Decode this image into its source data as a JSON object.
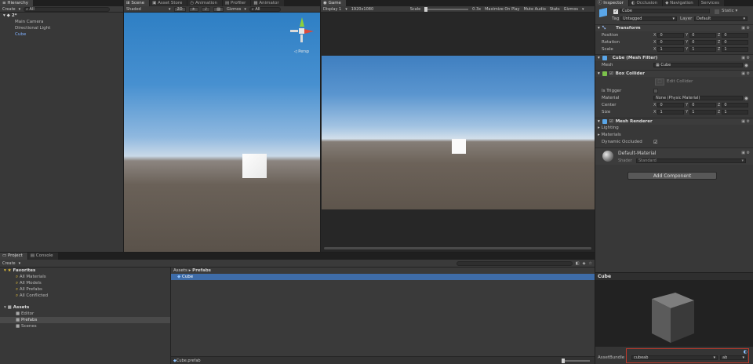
{
  "hierarchy": {
    "tab": "Hierarchy",
    "create": "Create",
    "search": "All",
    "scene": "2*",
    "items": [
      "Main Camera",
      "Directional Light",
      "Cube"
    ]
  },
  "scene_tabs": [
    "Scene",
    "Asset Store",
    "Animation",
    "Profiler",
    "Animator"
  ],
  "scene_toolbar": {
    "shading": "Shaded",
    "mode2d": "2D",
    "gizmos": "Gizmos",
    "search": "All",
    "persp": "Persp"
  },
  "game": {
    "tab": "Game",
    "display": "Display 1",
    "resolution": "1920x1080",
    "scale_label": "Scale",
    "scale_value": "0.3x",
    "maximize": "Maximize On Play",
    "mute": "Mute Audio",
    "stats": "Stats",
    "gizmos": "Gizmos"
  },
  "inspector": {
    "tabs": [
      "Inspector",
      "Occlusion",
      "Navigation",
      "Services"
    ],
    "object_name": "Cube",
    "static_label": "Static",
    "tag_label": "Tag",
    "tag_value": "Untagged",
    "layer_label": "Layer",
    "layer_value": "Default",
    "transform": {
      "title": "Transform",
      "position_label": "Position",
      "rotation_label": "Rotation",
      "scale_label": "Scale",
      "axis_x": "X",
      "axis_y": "Y",
      "axis_z": "Z",
      "position": [
        "0",
        "0",
        "0"
      ],
      "rotation": [
        "0",
        "0",
        "0"
      ],
      "scale": [
        "1",
        "1",
        "1"
      ]
    },
    "mesh_filter": {
      "title": "Cube (Mesh Filter)",
      "mesh_label": "Mesh",
      "mesh_value": "Cube"
    },
    "box_collider": {
      "title": "Box Collider",
      "edit_collider": "Edit Collider",
      "is_trigger_label": "Is Trigger",
      "material_label": "Material",
      "material_value": "None (Physic Material)",
      "center_label": "Center",
      "size_label": "Size",
      "center": [
        "0",
        "0",
        "0"
      ],
      "size": [
        "1",
        "1",
        "1"
      ]
    },
    "mesh_renderer": {
      "title": "Mesh Renderer",
      "lighting": "Lighting",
      "materials": "Materials",
      "dynamic_occluded": "Dynamic Occluded"
    },
    "material": {
      "name": "Default-Material",
      "shader_label": "Shader",
      "shader_value": "Standard"
    },
    "add_component": "Add Component",
    "preview_title": "Cube",
    "asset_bundle_label": "AssetBundle",
    "asset_bundle_value": "cubeab",
    "asset_bundle_variant": "ab"
  },
  "project": {
    "tabs": [
      "Project",
      "Console"
    ],
    "create": "Create",
    "favorites_label": "Favorites",
    "favorites": [
      "All Materials",
      "All Models",
      "All Prefabs",
      "All Conflicted"
    ],
    "assets_label": "Assets",
    "folders": [
      "Editor",
      "Prefabs",
      "Scenes"
    ],
    "breadcrumb_root": "Assets",
    "breadcrumb_sep": "▸",
    "breadcrumb_current": "Prefabs",
    "files": [
      "Cube"
    ],
    "footer_file": "Cube.prefab"
  },
  "colors": {
    "selection": "#3e6ca8",
    "asset_bundle_highlight": "#c0392b",
    "panel_bg": "#383838"
  }
}
